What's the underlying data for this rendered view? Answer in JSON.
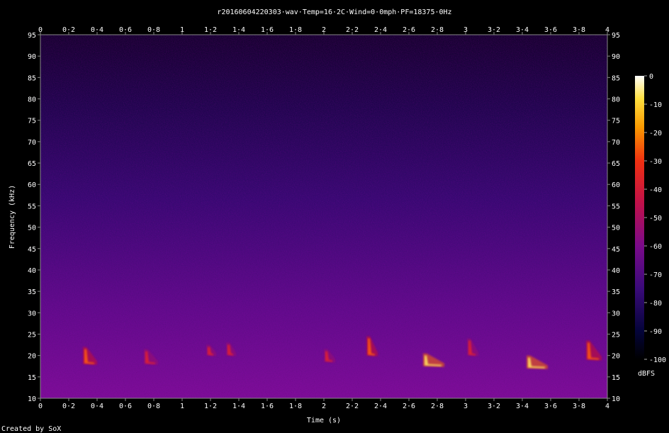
{
  "chart_data": {
    "type": "heatmap",
    "title": "r20160604220303·wav·Temp=16·2C·Wind=0·0mph·PF=18375·0Hz",
    "xlabel": "Time (s)",
    "ylabel": "Frequency (kHz)",
    "xlim": [
      0,
      4
    ],
    "ylim": [
      10,
      95
    ],
    "x_ticks": [
      "0",
      "0·2",
      "0·4",
      "0·6",
      "0·8",
      "1",
      "1·2",
      "1·4",
      "1·6",
      "1·8",
      "2",
      "2·2",
      "2·4",
      "2·6",
      "2·8",
      "3",
      "3·2",
      "3·4",
      "3·6",
      "3·8",
      "4"
    ],
    "y_ticks": [
      "10",
      "15",
      "20",
      "25",
      "30",
      "35",
      "40",
      "45",
      "50",
      "55",
      "60",
      "65",
      "70",
      "75",
      "80",
      "85",
      "90",
      "95"
    ],
    "colorbar": {
      "label": "dBFS",
      "ticks": [
        "0",
        "-10",
        "-20",
        "-30",
        "-40",
        "-50",
        "-60",
        "-70",
        "-80",
        "-90",
        "-100"
      ],
      "range": [
        -100,
        0
      ]
    },
    "calls": [
      {
        "t": 0.31,
        "f_start": 21.5,
        "f_end": 18.5,
        "dur": 0.07,
        "level": -55
      },
      {
        "t": 0.74,
        "f_start": 21.0,
        "f_end": 18.5,
        "dur": 0.07,
        "level": -58
      },
      {
        "t": 1.18,
        "f_start": 22.0,
        "f_end": 20.5,
        "dur": 0.04,
        "level": -68
      },
      {
        "t": 1.32,
        "f_start": 22.5,
        "f_end": 20.5,
        "dur": 0.04,
        "level": -64
      },
      {
        "t": 2.01,
        "f_start": 21.0,
        "f_end": 19.0,
        "dur": 0.05,
        "level": -60
      },
      {
        "t": 2.31,
        "f_start": 24.0,
        "f_end": 20.5,
        "dur": 0.05,
        "level": -55
      },
      {
        "t": 2.71,
        "f_start": 20.0,
        "f_end": 18.0,
        "dur": 0.12,
        "level": -35
      },
      {
        "t": 3.02,
        "f_start": 23.5,
        "f_end": 20.5,
        "dur": 0.05,
        "level": -60
      },
      {
        "t": 3.44,
        "f_start": 19.5,
        "f_end": 17.5,
        "dur": 0.12,
        "level": -35
      },
      {
        "t": 3.86,
        "f_start": 23.0,
        "f_end": 19.5,
        "dur": 0.08,
        "level": -55
      }
    ],
    "grid": false
  },
  "footer": "Created by SoX"
}
